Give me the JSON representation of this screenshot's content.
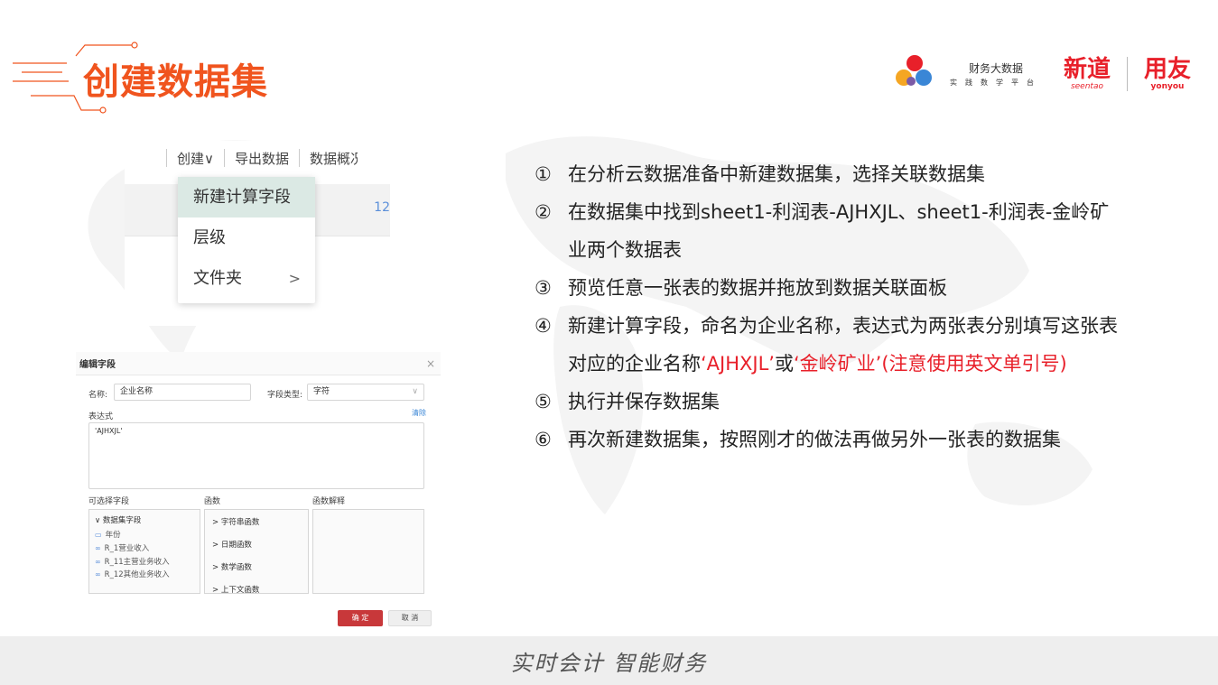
{
  "header": {
    "title": "创建数据集"
  },
  "brand": {
    "platform_name": "财务大数据",
    "platform_sub": "实践数学平台",
    "xindao": "新道",
    "xindao_en": "seentao",
    "yonyou": "用友",
    "yonyou_en": "yonyou"
  },
  "menu_shot": {
    "toolbar": [
      "创建∨",
      "导出数据",
      "数据概况"
    ],
    "grid_num": "12",
    "items": [
      {
        "label": "新建计算字段",
        "active": true
      },
      {
        "label": "层级",
        "active": false
      },
      {
        "label": "文件夹",
        "active": false,
        "arrow": ">"
      }
    ]
  },
  "dialog": {
    "title": "编辑字段",
    "close": "×",
    "name_label": "名称:",
    "name_value": "企业名称",
    "type_label": "字段类型:",
    "type_value": "字符",
    "type_arrow": "∨",
    "expr_label": "表达式",
    "clear": "清除",
    "expr_value": "'AJHXJL'",
    "col_fields": "可选择字段",
    "col_funcs": "函数",
    "col_desc": "函数解释",
    "fields_group": "∨  数据集字段",
    "fields": [
      "年份",
      "R_1营业收入",
      "R_11主营业务收入",
      "R_12其他业务收入"
    ],
    "funcs": [
      ">  字符串函数",
      ">  日期函数",
      ">  数学函数",
      ">  上下文函数"
    ],
    "ok": "确 定",
    "cancel": "取 消"
  },
  "steps": [
    {
      "num": "①",
      "parts": [
        {
          "t": "在分析云数据准备中新建数据集，选择关联数据集",
          "red": false
        }
      ]
    },
    {
      "num": "②",
      "parts": [
        {
          "t": "在数据集中找到sheet1-利润表-AJHXJL、sheet1-利润表-金岭矿业两个数据表",
          "red": false
        }
      ]
    },
    {
      "num": "③",
      "parts": [
        {
          "t": "预览任意一张表的数据并拖放到数据关联面板",
          "red": false
        }
      ]
    },
    {
      "num": "④",
      "parts": [
        {
          "t": "新建计算字段，命名为企业名称，表达式为两张表分别填写这张表对应的企业名称",
          "red": false
        },
        {
          "t": "‘AJHXJL’",
          "red": true
        },
        {
          "t": "或",
          "red": false
        },
        {
          "t": "‘金岭矿业’(注意使用英文单引号)",
          "red": true
        }
      ]
    },
    {
      "num": "⑤",
      "parts": [
        {
          "t": "执行并保存数据集",
          "red": false
        }
      ]
    },
    {
      "num": "⑥",
      "parts": [
        {
          "t": "再次新建数据集，按照刚才的做法再做另外一张表的数据集",
          "red": false
        }
      ]
    }
  ],
  "footer": {
    "slogan": "实时会计 智能财务"
  },
  "colors": {
    "accent": "#f0541e",
    "brand_red": "#e8202a"
  }
}
